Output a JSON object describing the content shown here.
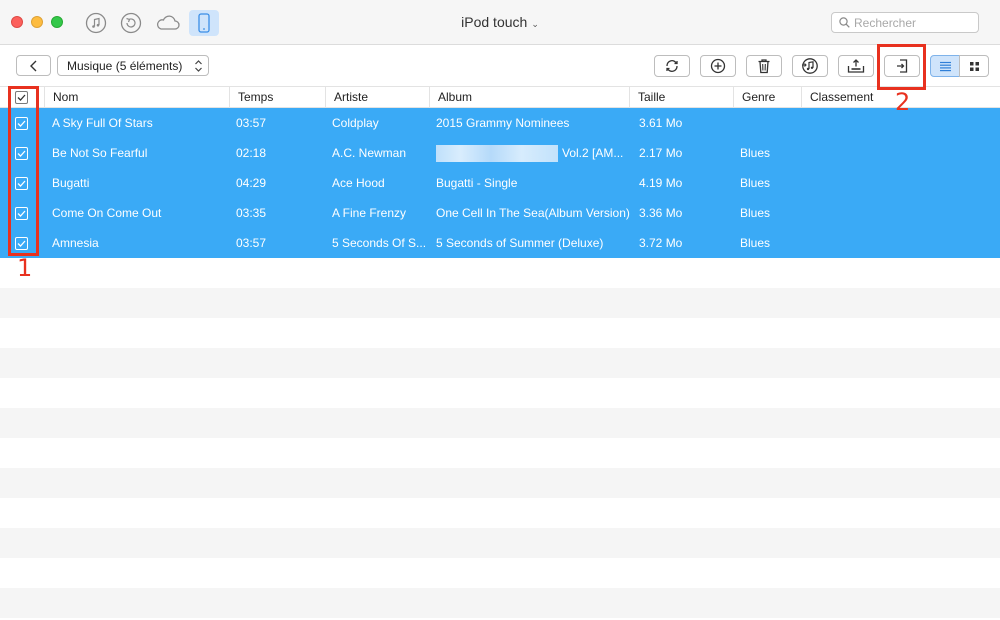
{
  "window": {
    "device_title": "iPod touch",
    "search_placeholder": "Rechercher"
  },
  "nav_icons": [
    "music-icon",
    "restore-icon",
    "cloud-icon",
    "device-icon"
  ],
  "toolbar": {
    "category_label": "Musique (5 éléments)",
    "buttons": [
      "refresh-icon",
      "add-icon",
      "trash-icon",
      "itunes-icon",
      "to-computer-icon",
      "to-device-icon"
    ],
    "view_modes": [
      "list-view-icon",
      "grid-view-icon"
    ]
  },
  "table": {
    "columns": [
      "Nom",
      "Temps",
      "Artiste",
      "Album",
      "Taille",
      "Genre",
      "Classement"
    ],
    "rows": [
      {
        "name": "A Sky Full Of Stars",
        "time": "03:57",
        "artist": "Coldplay",
        "album": "2015 Grammy Nominees",
        "size": "3.61 Mo",
        "genre": ""
      },
      {
        "name": "Be Not So Fearful",
        "time": "02:18",
        "artist": "A.C. Newman",
        "album": "Vol.2 [AM...",
        "size": "2.17 Mo",
        "genre": "Blues"
      },
      {
        "name": "Bugatti",
        "time": "04:29",
        "artist": "Ace Hood",
        "album": "Bugatti - Single",
        "size": "4.19 Mo",
        "genre": "Blues"
      },
      {
        "name": "Come On Come Out",
        "time": "03:35",
        "artist": "A Fine Frenzy",
        "album": "One Cell In The Sea(Album Version)",
        "size": "3.36 Mo",
        "genre": "Blues"
      },
      {
        "name": "Amnesia",
        "time": "03:57",
        "artist": "5 Seconds Of S...",
        "album": "5 Seconds of Summer (Deluxe)",
        "size": "3.72 Mo",
        "genre": "Blues"
      }
    ]
  },
  "annotations": {
    "one": "1",
    "two": "2"
  },
  "colors": {
    "selection": "#3aaaf6",
    "annotation": "#e8311f",
    "active_tab": "#cfe4fb"
  }
}
